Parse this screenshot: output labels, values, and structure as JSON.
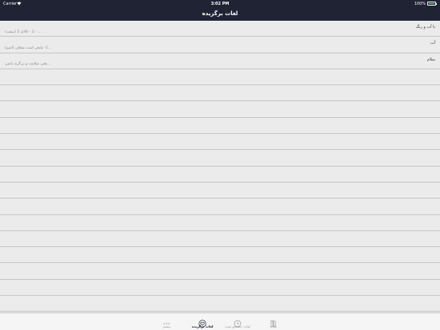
{
  "status_bar": {
    "carrier": "Carrier",
    "time": "3:02 PM",
    "battery": "100%"
  },
  "nav": {
    "title": "لغات برگزیده"
  },
  "rows": [
    {
      "word": "با آب و رنگ",
      "meaning": "(صفت) 1 - کالای  2 - ..."
    },
    {
      "word": "آب",
      "meaning": "(اسم) 1- مایعی است شفاف..."
    },
    {
      "word": "سلام",
      "meaning": "یعنی سلامت و بی‌گزند باشی..."
    },
    {
      "word": "",
      "meaning": ""
    },
    {
      "word": "",
      "meaning": ""
    },
    {
      "word": "",
      "meaning": ""
    },
    {
      "word": "",
      "meaning": ""
    },
    {
      "word": "",
      "meaning": ""
    },
    {
      "word": "",
      "meaning": ""
    },
    {
      "word": "",
      "meaning": ""
    },
    {
      "word": "",
      "meaning": ""
    },
    {
      "word": "",
      "meaning": ""
    },
    {
      "word": "",
      "meaning": ""
    },
    {
      "word": "",
      "meaning": ""
    },
    {
      "word": "",
      "meaning": ""
    },
    {
      "word": "",
      "meaning": ""
    },
    {
      "word": "",
      "meaning": ""
    },
    {
      "word": "",
      "meaning": ""
    }
  ],
  "tabs": [
    {
      "label": "بیشتر",
      "icon": "more-icon",
      "active": false
    },
    {
      "label": "لغات برگزیده",
      "icon": "heart-icon",
      "active": true
    },
    {
      "label": "لغات جستجو شده",
      "icon": "history-icon",
      "active": false
    },
    {
      "label": "لغات",
      "icon": "book-icon",
      "active": false
    }
  ],
  "colors": {
    "bar": "#1f2333",
    "background": "#ebebeb",
    "battery": "#4cd964"
  }
}
